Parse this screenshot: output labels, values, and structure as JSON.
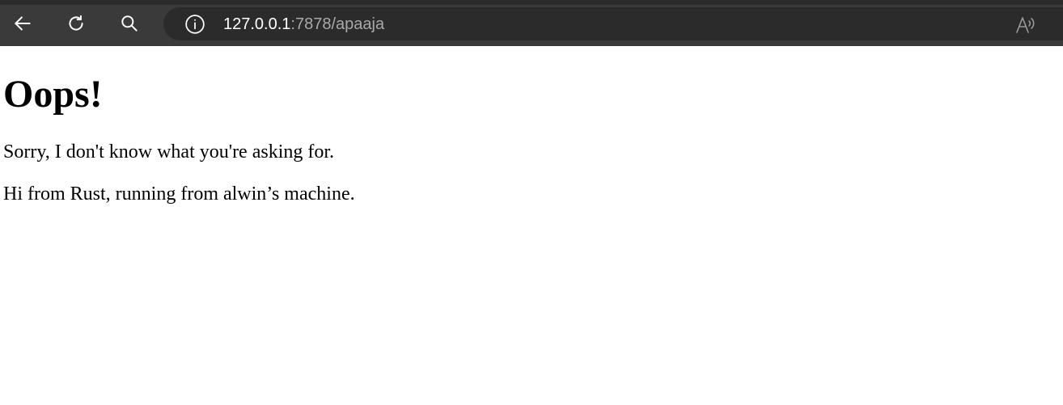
{
  "browser": {
    "url_host": "127.0.0.1",
    "url_path": ":7878/apaaja",
    "icons": {
      "back": "back-arrow-icon",
      "reload": "reload-icon",
      "search": "search-icon",
      "site_info": "info-icon",
      "read_aloud": "read-aloud-icon"
    }
  },
  "page": {
    "heading": "Oops!",
    "message": "Sorry, I don't know what you're asking for.",
    "footer": "Hi from Rust, running from alwin’s machine."
  }
}
